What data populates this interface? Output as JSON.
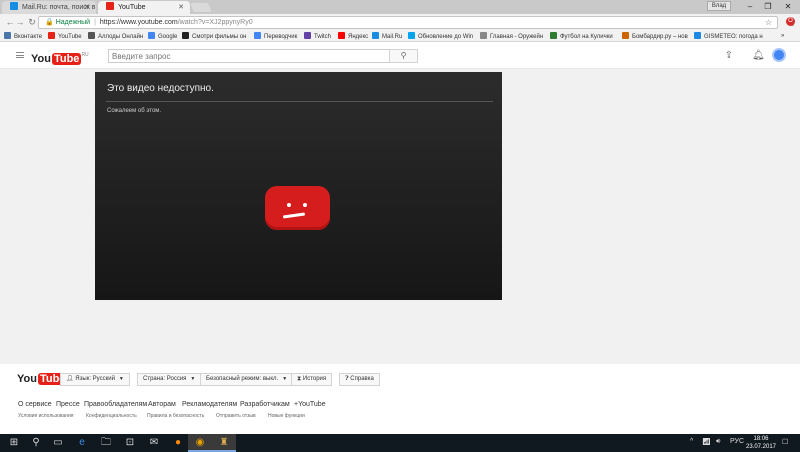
{
  "browser": {
    "tabs": [
      {
        "title": "Mail.Ru: почта, поиск в",
        "active": false
      },
      {
        "title": "YouTube",
        "active": true
      }
    ],
    "user_chip": "Влад",
    "address": {
      "secure_label": "Надежный",
      "scheme_host": "https://www.youtube.com",
      "path": "/watch?v=XJ2ppynyRy0"
    },
    "bookmarks": [
      {
        "label": "Вконтакте",
        "icon_color": "#4a76a8"
      },
      {
        "label": "YouTube",
        "icon_color": "#e62117"
      },
      {
        "label": "Аллоды Онлайн",
        "icon_color": "#555555"
      },
      {
        "label": "Google",
        "icon_color": "#4285f4"
      },
      {
        "label": "Смотри фильмы он",
        "icon_color": "#222222",
        "icon_text": "HD"
      },
      {
        "label": "Переводчик",
        "icon_color": "#4285f4"
      },
      {
        "label": "Twitch",
        "icon_color": "#6441a5"
      },
      {
        "label": "Яндекс",
        "icon_color": "#ff0000",
        "icon_text": "Я"
      },
      {
        "label": "Mail.Ru",
        "icon_color": "#168de2"
      },
      {
        "label": "Обновление до Win",
        "icon_color": "#00a4ef"
      },
      {
        "label": "Главная - Оружейн",
        "icon_color": "#888888"
      },
      {
        "label": "Футбол на Кулички",
        "icon_color": "#2e7d32"
      },
      {
        "label": "Бомбардир.ру – нов",
        "icon_color": "#cc6600"
      },
      {
        "label": "GISMETEO: погода н",
        "icon_color": "#1e88e5"
      }
    ]
  },
  "youtube": {
    "logo_you": "You",
    "logo_tube": "Tube",
    "logo_region": "RU",
    "search_placeholder": "Введите запрос",
    "error": {
      "title": "Это видео недоступно.",
      "subtitle": "Сожалеем об этом."
    },
    "footer": {
      "buttons": [
        {
          "label": "Язык: Русский",
          "caret": true
        },
        {
          "label": "Страна: Россия",
          "caret": true
        },
        {
          "label": "Безопасный режим: выкл.",
          "caret": true
        },
        {
          "label": "История",
          "caret": false
        },
        {
          "label": "Справка",
          "caret": false
        }
      ],
      "links": [
        "О сервисе",
        "Прессе",
        "Правообладателям",
        "Авторам",
        "Рекламодателям",
        "Разработчикам",
        "+YouTube"
      ],
      "links2": [
        "Условия использования",
        "Конфиденциальность",
        "Правила и безопасность",
        "Отправить отзыв",
        "Новые функции"
      ]
    }
  },
  "taskbar": {
    "lang": "РУС",
    "time": "18:06",
    "date": "23.07.2017"
  },
  "colors": {
    "brand_red": "#e62117",
    "player_bg": "#1f1f1f",
    "error_icon": "#d61d1d"
  }
}
